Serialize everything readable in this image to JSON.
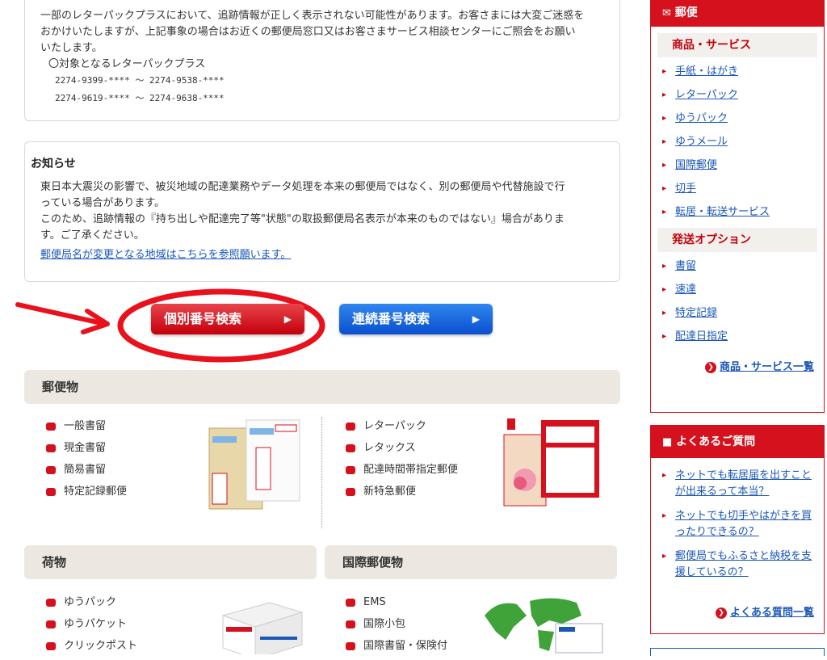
{
  "notice1": {
    "text1": "一部のレターパックプラスにおいて、追跡情報が正しく表示されない可能性があります。お客さまには大変ご迷惑を",
    "text2": "おかけいたしますが、上記事象の場合はお近くの郵便局窓口又はお客さまサービス相談センターにご照会をお願い",
    "text3": "いたします。",
    "subhead": "〇対象となるレターパックプラス",
    "range1": "2274-9399-**** 〜 2274-9538-****",
    "range2": "2274-9619-**** 〜 2274-9638-****"
  },
  "notice2": {
    "title": "お知らせ",
    "line1": "東日本大震災の影響で、被災地域の配達業務やデータ処理を本来の郵便局ではなく、別の郵便局や代替施設で行",
    "line2": "っている場合があります。",
    "line3": "このため、追跡情報の『持ち出しや配達完了等\"状態\"の取扱郵便局名表示が本来のものではない』場合がありま",
    "line4": "す。ご了承ください。",
    "link": "郵便局名が変更となる地域はこちらを参照願います。"
  },
  "buttons": {
    "individual": "個別番号検索",
    "continuous": "連続番号検索",
    "arrow": "▶"
  },
  "sections": {
    "mail": {
      "title": "郵便物",
      "left": [
        "一般書留",
        "現金書留",
        "簡易書留",
        "特定記録郵便"
      ],
      "right": [
        "レターパック",
        "レタックス",
        "配達時間帯指定郵便",
        "新特急郵便"
      ]
    },
    "parcel": {
      "title": "荷物",
      "items": [
        "ゆうパック",
        "ゆうパケット",
        "クリックポスト"
      ]
    },
    "intl": {
      "title": "国際郵便物",
      "items": [
        "EMS",
        "国際小包",
        "国際書留・保険付"
      ]
    }
  },
  "sidebar": {
    "mail_title": "郵便",
    "goods_title": "商品・サービス",
    "goods": [
      "手紙・はがき",
      "レターパック",
      "ゆうパック",
      "ゆうメール",
      "国際郵便",
      "切手",
      "転居・転送サービス"
    ],
    "options_title": "発送オプション",
    "options": [
      "書留",
      "速達",
      "特定記録",
      "配達日指定"
    ],
    "goods_all": "商品・サービス一覧",
    "faq_title": "よくあるご質問",
    "faq": [
      "ネットでも転居届を出すことが出来るって本当？",
      "ネットでも切手やはがきを買ったりできるの？",
      "郵便局でもふるさと納税を支援しているの？"
    ],
    "faq_all": "よくある質問一覧"
  },
  "colors": {
    "accent_red": "#d4111c",
    "button_blue": "#0a4fcf",
    "annotation_red": "#e8111c"
  }
}
